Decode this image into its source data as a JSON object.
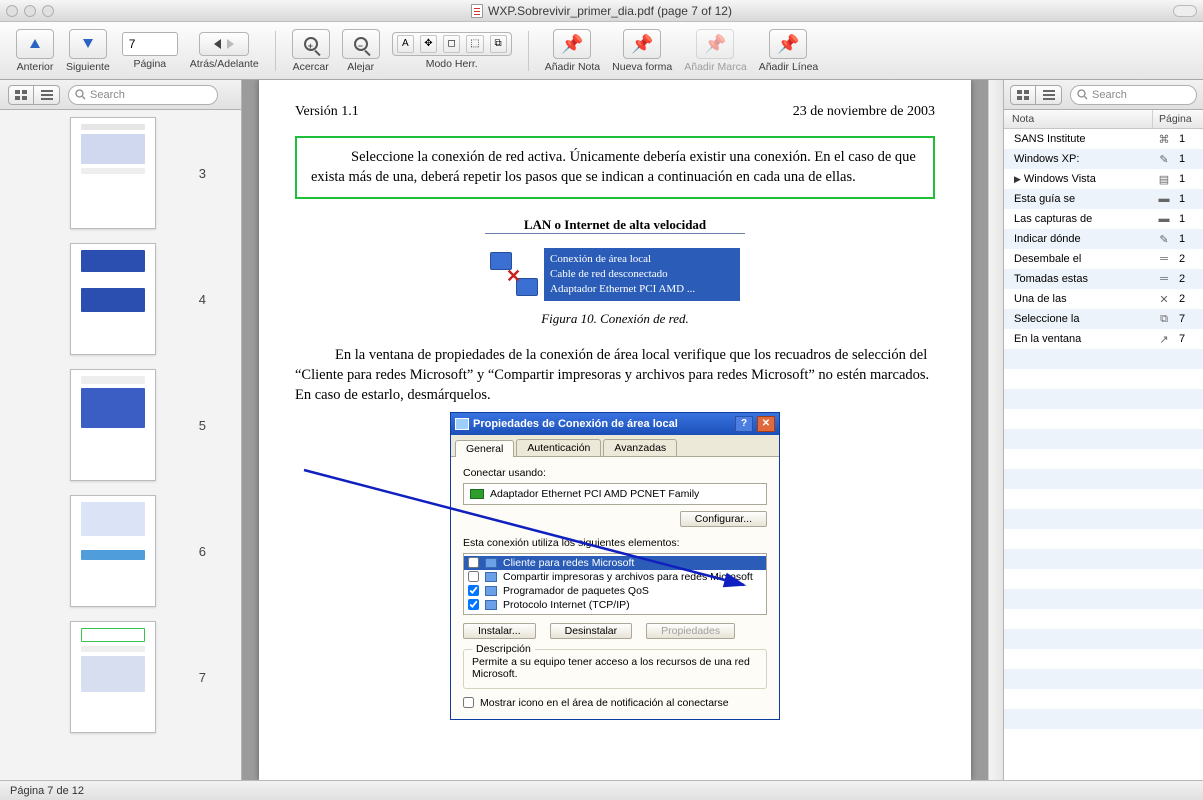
{
  "window": {
    "title": "WXP.Sobrevivir_primer_dia.pdf (page 7 of 12)"
  },
  "toolbar": {
    "anterior": "Anterior",
    "siguiente": "Siguiente",
    "pagina": "Página",
    "page_value": "7",
    "atras_adelante": "Atrás/Adelante",
    "acercar": "Acercar",
    "alejar": "Alejar",
    "modo_herr": "Modo Herr.",
    "anadir_nota": "Añadir Nota",
    "nueva_forma": "Nueva forma",
    "anadir_marca": "Añadir Marca",
    "anadir_linea": "Añadir Línea"
  },
  "search_placeholder": "Search",
  "thumbnails": [
    {
      "num": "3"
    },
    {
      "num": "4"
    },
    {
      "num": "5"
    },
    {
      "num": "6"
    },
    {
      "num": "7"
    }
  ],
  "doc": {
    "version": "Versión 1.1",
    "date": "23 de noviembre de 2003",
    "green_para": "Seleccione la conexión de red activa. Únicamente debería existir una conexión. En el caso de que exista más de una, deberá repetir los pasos que se indican a continuación en cada una de ellas.",
    "lan_header": "LAN o Internet de alta velocidad",
    "net_line1": "Conexión de área local",
    "net_line2": "Cable de red desconectado",
    "net_line3": "Adaptador Ethernet PCI AMD ...",
    "fig_caption": "Figura 10. Conexión de red.",
    "para2": "En la ventana de propiedades de la conexión de área local verifique que los recuadros de selección del “Cliente para redes Microsoft” y “Compartir impresoras y archivos para redes Microsoft” no estén marcados. En caso de estarlo, desmárquelos."
  },
  "dialog": {
    "title": "Propiedades de Conexión de área local",
    "tab_general": "General",
    "tab_auth": "Autenticación",
    "tab_adv": "Avanzadas",
    "connect_using": "Conectar usando:",
    "adapter": "Adaptador Ethernet PCI AMD PCNET Family",
    "configure": "Configurar...",
    "elements_label": "Esta conexión utiliza los siguientes elementos:",
    "el1": "Cliente para redes Microsoft",
    "el2": "Compartir impresoras y archivos para redes Microsoft",
    "el3": "Programador de paquetes QoS",
    "el4": "Protocolo Internet (TCP/IP)",
    "install": "Instalar...",
    "uninstall": "Desinstalar",
    "properties": "Propiedades",
    "desc_title": "Descripción",
    "desc_text": "Permite a su equipo tener acceso a los recursos de una red Microsoft.",
    "show_icon": "Mostrar icono en el área de notificación al conectarse"
  },
  "annotations": {
    "col_nota": "Nota",
    "col_pagina": "Página",
    "rows": [
      {
        "text": "SANS Institute",
        "icon": "link",
        "page": "1"
      },
      {
        "text": "Windows XP:",
        "icon": "pencil",
        "page": "1"
      },
      {
        "text": "Windows Vista",
        "icon": "note",
        "page": "1",
        "arrow": true
      },
      {
        "text": "Esta guía se",
        "icon": "dash",
        "page": "1"
      },
      {
        "text": "Las capturas de",
        "icon": "dash",
        "page": "1"
      },
      {
        "text": "Indicar dónde",
        "icon": "pencil",
        "page": "1"
      },
      {
        "text": "Desembale el",
        "icon": "equals",
        "page": "2"
      },
      {
        "text": "Tomadas estas",
        "icon": "equals",
        "page": "2"
      },
      {
        "text": "Una de las",
        "icon": "cross",
        "page": "2"
      },
      {
        "text": "Seleccione la",
        "icon": "box",
        "page": "7"
      },
      {
        "text": "En la ventana",
        "icon": "arrow",
        "page": "7"
      }
    ]
  },
  "status": "Página 7 de 12"
}
